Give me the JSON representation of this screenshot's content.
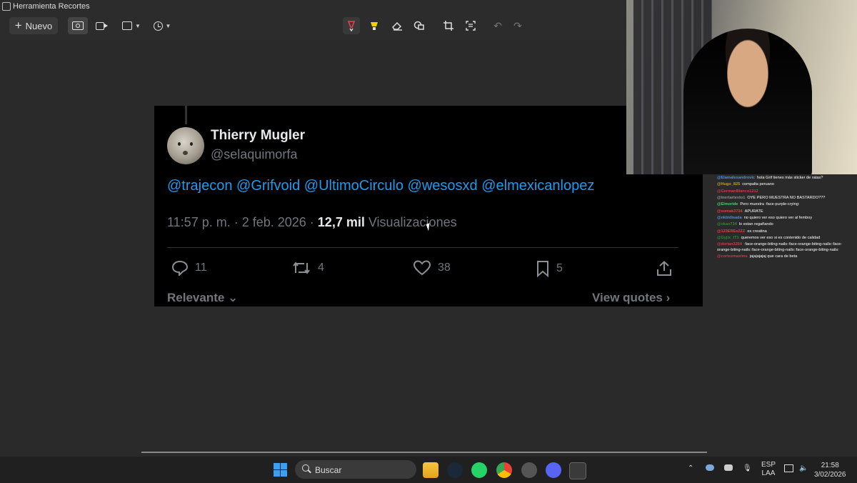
{
  "window": {
    "title": "Herramienta Recortes"
  },
  "toolbar": {
    "new_label": "Nuevo"
  },
  "tweet": {
    "author": "Thierry Mugler",
    "handle": "@selaquimorfa",
    "mentions": "@trajecon @Grifvoid @UltimoCirculo @wesosxd @elmexicanlopez",
    "time_date": "11:57 p. m. · 2 feb. 2026 · ",
    "views_count": "12,7 mil",
    "views_label": " Visualizaciones",
    "replies": "11",
    "reposts": "4",
    "likes": "38",
    "bookmarks": "5",
    "sort_label": "Relevante",
    "quotes_label": "View quotes"
  },
  "chat": {
    "messages": [
      {
        "user": "@Elamalexandrovic",
        "color": "#4a8fe0",
        "text": "hola Grif tienes más sticker de ratas?"
      },
      {
        "user": "@Hugo_825",
        "color": "#c79a2c",
        "text": "compalta peruano"
      },
      {
        "user": "@GermanBlanco1212",
        "color": "#d0384c",
        "text": ""
      },
      {
        "user": "@Inertartexto1",
        "color": "#8f8f8f",
        "text": "OYE PERO MUESTRA NO BASTARDO???"
      },
      {
        "user": "@Elmoride",
        "color": "#3fd36a",
        "text": "Pero muestra :face-purple-crying:"
      },
      {
        "user": "@somak3734",
        "color": "#e04040",
        "text": "APURATE"
      },
      {
        "user": "@nkbidisada",
        "color": "#4a8fe0",
        "text": "no quiero ver eso quiero ver al femboy"
      },
      {
        "user": "@okao734",
        "color": "#2f8a3a",
        "text": "lo estan regañando"
      },
      {
        "user": "@123EREs2ZZ",
        "color": "#e04040",
        "text": "es creatina"
      },
      {
        "user": "@Gyjix_tT1",
        "color": "#2f8a3a",
        "text": "queremos ver eso si es contenido de calidad"
      },
      {
        "user": "@dorian3264",
        "color": "#d0384c",
        "text": ":face-orange-biting-nails::face-orange-biting-nails::face-orange-biting-nails::face-orange-biting-nails::face-orange-biting-nails:"
      },
      {
        "user": "@cortezmaxims",
        "color": "#d0384c",
        "text": "jajajajajaj que cara de beta"
      }
    ]
  },
  "taskbar": {
    "search_placeholder": "Buscar",
    "lang_1": "ESP",
    "lang_2": "LAA",
    "time": "21:58",
    "date": "3/02/2026"
  }
}
